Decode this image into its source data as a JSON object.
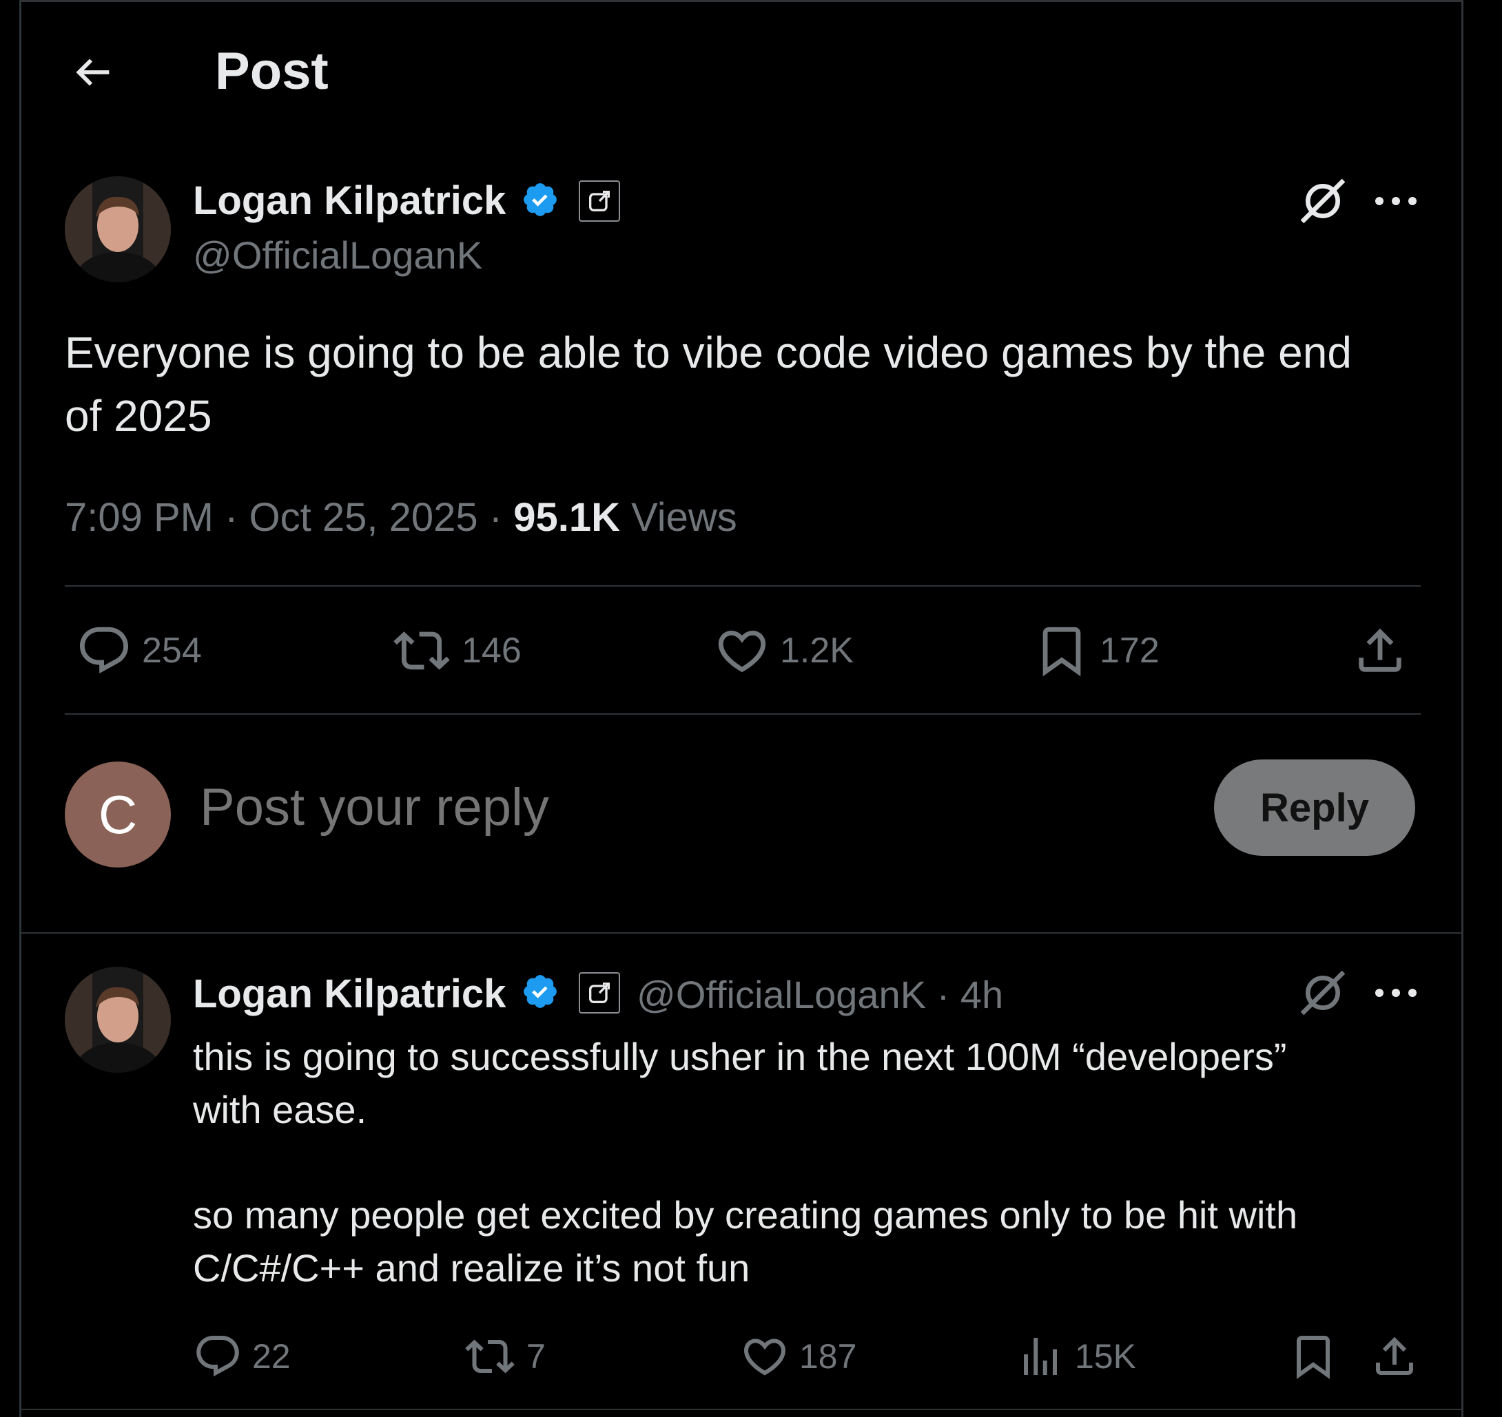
{
  "header": {
    "title": "Post"
  },
  "main_post": {
    "author": {
      "name": "Logan Kilpatrick",
      "handle": "@OfficialLoganK"
    },
    "text_line1": "Everyone is going to be able to vibe code video games by the end",
    "text_line2": "of 2025",
    "time": "7:09 PM · Oct 25, 2025 · ",
    "views_count": "95.1K",
    "views_label": " Views",
    "stats": {
      "replies": "254",
      "reposts": "146",
      "likes": "1.2K",
      "bookmarks": "172"
    }
  },
  "reply_box": {
    "avatar_letter": "C",
    "placeholder": "Post your reply",
    "button": "Reply"
  },
  "reply_post": {
    "author": {
      "name": "Logan Kilpatrick",
      "handle": "@OfficialLoganK",
      "time": " · 4h"
    },
    "line1": "this is going to successfully usher in the next 100M “developers”",
    "line2": "with ease.",
    "line3": "so many people get excited by creating games only to be hit with",
    "line4": "C/C#/C++ and realize it’s not fun",
    "stats": {
      "replies": "22",
      "reposts": "7",
      "likes": "187",
      "views": "15K"
    }
  },
  "icons": [
    "back-arrow-icon",
    "verified-badge-icon",
    "affiliate-icon",
    "grok-icon",
    "more-icon",
    "reply-icon",
    "repost-icon",
    "like-icon",
    "bookmark-icon",
    "share-icon",
    "views-icon"
  ],
  "colors": {
    "background": "#000000",
    "text": "#e7e9ea",
    "muted": "#71767b",
    "verified": "#1d9bf0",
    "divider": "#2f3336",
    "reply_button": "#787a7c",
    "reply_avatar": "#8a6257"
  }
}
